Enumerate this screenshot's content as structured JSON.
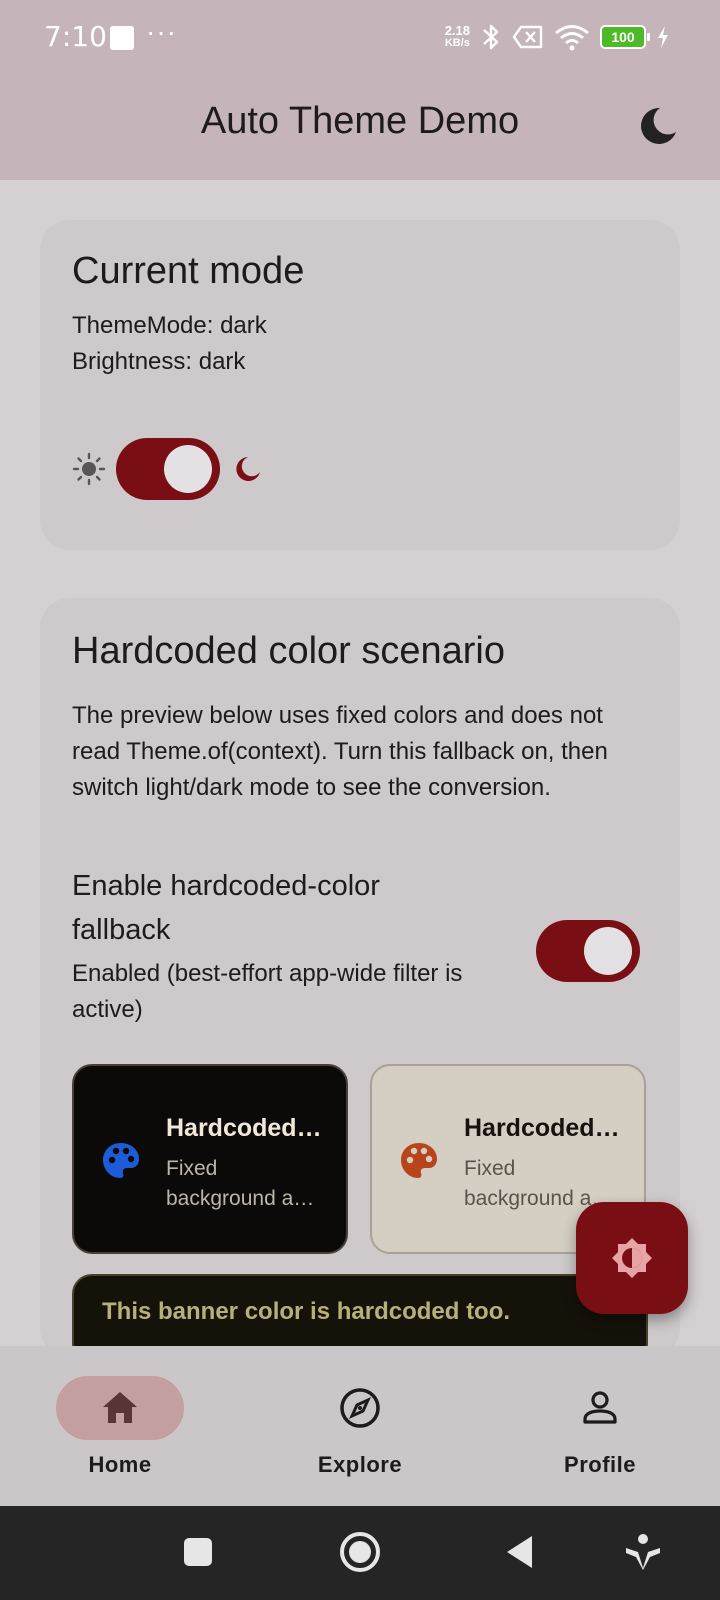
{
  "status": {
    "time": "7:10",
    "dots": "···",
    "net_speed_value": "2.18",
    "net_speed_unit": "KB/s",
    "battery": "100"
  },
  "appbar": {
    "title": "Auto Theme Demo",
    "theme_icon": "moon-icon"
  },
  "current_mode": {
    "title": "Current mode",
    "theme_mode": "ThemeMode: dark",
    "brightness": "Brightness: dark",
    "switch_on": true
  },
  "hardcoded": {
    "title": "Hardcoded color scenario",
    "description": "The preview below uses fixed colors and does not read Theme.of(context). Turn this fallback on, then switch light/dark mode to see the conversion.",
    "fallback_title": "Enable hardcoded-color fallback",
    "fallback_status": "Enabled (best-effort app-wide filter is active)",
    "switch_on": true,
    "previews": [
      {
        "title": "Hardcoded …",
        "line1": "Fixed",
        "line2": "background a…",
        "icon": "palette-icon",
        "icon_color": "#1e5bd8"
      },
      {
        "title": "Hardcoded …",
        "line1": "Fixed",
        "line2": "background a…",
        "icon": "palette-icon",
        "icon_color": "#b8441c"
      }
    ],
    "banner": "This banner color is hardcoded too."
  },
  "fab": {
    "icon": "brightness-icon"
  },
  "bottom_nav": {
    "items": [
      {
        "label": "Home",
        "icon": "home-icon",
        "active": true
      },
      {
        "label": "Explore",
        "icon": "compass-icon",
        "active": false
      },
      {
        "label": "Profile",
        "icon": "person-icon",
        "active": false
      }
    ]
  },
  "colors": {
    "primary": "#7a0e15",
    "appbar": "#c5b4b9",
    "background": "#d5d0d1",
    "card": "#cec9ca"
  }
}
